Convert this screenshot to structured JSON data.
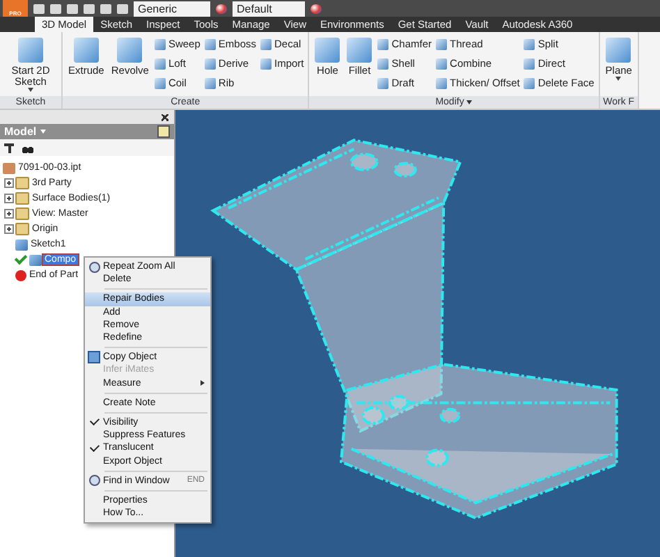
{
  "title_bar": {
    "app_button": "PRO",
    "workspace": "Generic",
    "appearance": "Default"
  },
  "tabs": [
    {
      "label": "3D Model",
      "selected": true
    },
    {
      "label": "Sketch",
      "selected": false
    },
    {
      "label": "Inspect",
      "selected": false
    },
    {
      "label": "Tools",
      "selected": false
    },
    {
      "label": "Manage",
      "selected": false
    },
    {
      "label": "View",
      "selected": false
    },
    {
      "label": "Environments",
      "selected": false
    },
    {
      "label": "Get Started",
      "selected": false
    },
    {
      "label": "Vault",
      "selected": false
    },
    {
      "label": "Autodesk A360",
      "selected": false
    }
  ],
  "ribbon": {
    "panels": [
      {
        "title": "Sketch",
        "menu": false,
        "large": [
          {
            "label": "Start 2D Sketch",
            "dropdown": true
          }
        ]
      },
      {
        "title": "Create",
        "menu": false,
        "large": [
          {
            "label": "Extrude",
            "dropdown": false
          },
          {
            "label": "Revolve",
            "dropdown": false
          }
        ],
        "columns": [
          [
            "Sweep",
            "Loft",
            "Coil"
          ],
          [
            "Emboss",
            "Derive",
            "Rib"
          ],
          [
            "Decal",
            "Import"
          ]
        ]
      },
      {
        "title": "Modify",
        "menu": true,
        "large": [
          {
            "label": "Hole",
            "dropdown": false
          },
          {
            "label": "Fillet",
            "dropdown": false
          }
        ],
        "columns": [
          [
            "Chamfer",
            "Shell",
            "Draft"
          ],
          [
            "Thread",
            "Combine",
            "Thicken/ Offset"
          ],
          [
            "Split",
            "Direct",
            "Delete Face"
          ]
        ]
      },
      {
        "title": "Work F",
        "menu": false,
        "large": [
          {
            "label": "Plane",
            "dropdown": true
          }
        ]
      }
    ]
  },
  "browser": {
    "title": "Model",
    "tree": {
      "label": "7091-00-03.ipt",
      "kind": "part",
      "selected": false,
      "children": [
        {
          "label": "3rd Party",
          "kind": "group",
          "expanded": false,
          "selected": false
        },
        {
          "label": "Surface Bodies(1)",
          "kind": "group",
          "expanded": false,
          "selected": false
        },
        {
          "label": "View: Master",
          "kind": "group",
          "expanded": false,
          "selected": false
        },
        {
          "label": "Origin",
          "kind": "group",
          "expanded": false,
          "selected": false
        },
        {
          "label": "Sketch1",
          "kind": "leaf",
          "selected": false
        },
        {
          "label": "Compo",
          "kind": "leaf",
          "selected": true,
          "checked": true
        },
        {
          "label": "End of Part",
          "kind": "end",
          "selected": false
        }
      ]
    }
  },
  "context_menu": [
    {
      "kind": "zoom_item",
      "label": "Repeat Zoom All",
      "selected": false,
      "disabled": false,
      "checked": false
    },
    {
      "kind": "item",
      "label": "Delete",
      "selected": false,
      "disabled": false,
      "checked": false
    },
    {
      "kind": "separator"
    },
    {
      "kind": "item",
      "label": "Repair Bodies",
      "selected": true,
      "disabled": false,
      "checked": false
    },
    {
      "kind": "item",
      "label": "Add",
      "selected": false,
      "disabled": false,
      "checked": false
    },
    {
      "kind": "item",
      "label": "Remove",
      "selected": false,
      "disabled": false,
      "checked": false
    },
    {
      "kind": "item",
      "label": "Redefine",
      "selected": false,
      "disabled": false,
      "checked": false
    },
    {
      "kind": "separator"
    },
    {
      "kind": "copy_item",
      "label": "Copy Object",
      "selected": false,
      "disabled": false,
      "checked": false
    },
    {
      "kind": "item",
      "label": "Infer iMates",
      "selected": false,
      "disabled": true,
      "checked": false
    },
    {
      "kind": "item",
      "label": "Measure",
      "submenu": true,
      "selected": false,
      "disabled": false,
      "checked": false
    },
    {
      "kind": "separator"
    },
    {
      "kind": "item",
      "label": "Create Note",
      "selected": false,
      "disabled": false,
      "checked": false
    },
    {
      "kind": "separator"
    },
    {
      "kind": "item",
      "label": "Visibility",
      "selected": false,
      "disabled": false,
      "checked": true
    },
    {
      "kind": "item",
      "label": "Suppress Features",
      "selected": false,
      "disabled": false,
      "checked": false
    },
    {
      "kind": "item",
      "label": "Translucent",
      "selected": false,
      "disabled": false,
      "checked": true
    },
    {
      "kind": "item",
      "label": "Export Object",
      "selected": false,
      "disabled": false,
      "checked": false
    },
    {
      "kind": "separator"
    },
    {
      "kind": "zoom_item",
      "label": "Find in Window",
      "shortcut": "END",
      "selected": false,
      "disabled": false,
      "checked": false
    },
    {
      "kind": "separator"
    },
    {
      "kind": "item",
      "label": "Properties",
      "selected": false,
      "disabled": false,
      "checked": false
    },
    {
      "kind": "item",
      "label": "How To...",
      "selected": false,
      "disabled": false,
      "checked": false
    }
  ]
}
